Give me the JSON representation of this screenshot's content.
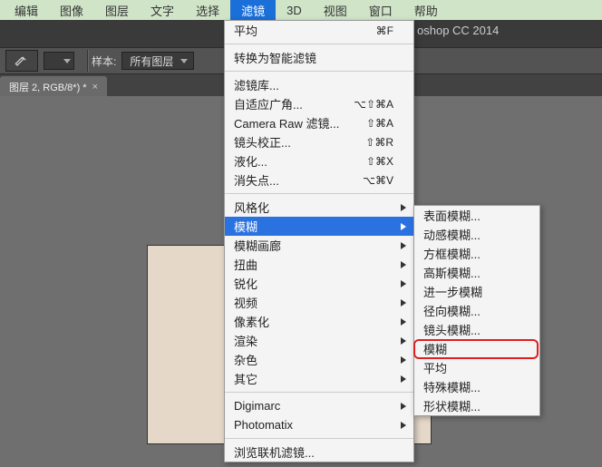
{
  "menubar": {
    "items": [
      "编辑",
      "图像",
      "图层",
      "文字",
      "选择",
      "滤镜",
      "3D",
      "视图",
      "窗口",
      "帮助"
    ],
    "active_index": 5
  },
  "app_title": "oshop CC 2014",
  "optionbar": {
    "sample_label": "样本:",
    "sample_value": "所有图层"
  },
  "tab": {
    "label": "图层 2, RGB/8*) *"
  },
  "filter_menu": {
    "recent": {
      "label": "平均",
      "shortcut": "⌘F"
    },
    "smart": "转换为智能滤镜",
    "gallery": "滤镜库...",
    "adaptive": {
      "label": "自适应广角...",
      "shortcut": "⌥⇧⌘A"
    },
    "cameraraw": {
      "label": "Camera Raw 滤镜...",
      "shortcut": "⇧⌘A"
    },
    "lens": {
      "label": "镜头校正...",
      "shortcut": "⇧⌘R"
    },
    "liquify": {
      "label": "液化...",
      "shortcut": "⇧⌘X"
    },
    "vanish": {
      "label": "消失点...",
      "shortcut": "⌥⌘V"
    },
    "groups": {
      "stylize": "风格化",
      "blur": "模糊",
      "blurgallery": "模糊画廊",
      "distort": "扭曲",
      "sharpen": "锐化",
      "video": "视频",
      "pixelate": "像素化",
      "render": "渲染",
      "noise": "杂色",
      "other": "其它"
    },
    "digimarc": "Digimarc",
    "photomatix": "Photomatix",
    "browse": "浏览联机滤镜..."
  },
  "blur_submenu": {
    "surface": "表面模糊...",
    "motion": "动感模糊...",
    "box": "方框模糊...",
    "gaussian": "高斯模糊...",
    "further": "进一步模糊",
    "radial": "径向模糊...",
    "lens": "镜头模糊...",
    "blur": "模糊",
    "average": "平均",
    "smart": "特殊模糊...",
    "shape": "形状模糊..."
  }
}
